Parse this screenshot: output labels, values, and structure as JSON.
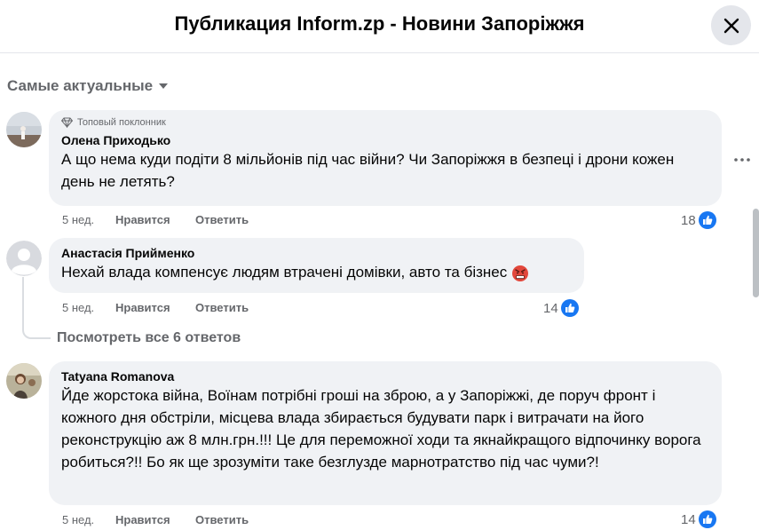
{
  "header": {
    "title": "Публикация Inform.zp - Новини Запоріжжя"
  },
  "sort": {
    "label": "Самые актуальные"
  },
  "comments": [
    {
      "badge": "Топовый поклонник",
      "author": "Олена Приходько",
      "text": "А що нема куди подіти 8 мільйонів під час війни? Чи Запоріжжя в безпеці і дрони кожен день не летять?",
      "time": "5 нед.",
      "like": "Нравится",
      "reply": "Ответить",
      "reactions": "18"
    },
    {
      "author": "Анастасія Прийменко",
      "text": "Нехай влада компенсує людям втрачені домівки, авто та бізнес",
      "time": "5 нед.",
      "like": "Нравится",
      "reply": "Ответить",
      "reactions": "14"
    },
    {
      "author": "Tatyana Romanova",
      "text": "Йде жорстока війна, Воїнам потрібні гроші на зброю, а у Запоріжжі, де поруч фронт і кожного дня обстріли, місцева влада збирається будувати парк і витрачати на його реконструкцію аж 8 млн.грн.!!! Це для переможної ходи та якнайкращого відпочинку ворога робиться?!! Бо як ще зрозуміти таке безглузде марнотратство під час чуми?!",
      "time": "5 нед.",
      "like": "Нравится",
      "reply": "Ответить",
      "reactions": "14"
    }
  ],
  "replies": {
    "label": "Посмотреть все 6 ответов"
  },
  "icons": {
    "close": "close-icon",
    "sort": "caret-down-icon",
    "badge": "diamond-icon",
    "more": "more-dots-icon",
    "like": "thumbs-up-icon",
    "emoji": "angry-face-icon"
  },
  "colors": {
    "accent": "#1877f2",
    "bubble": "#f0f2f5",
    "muted": "#65676b"
  }
}
